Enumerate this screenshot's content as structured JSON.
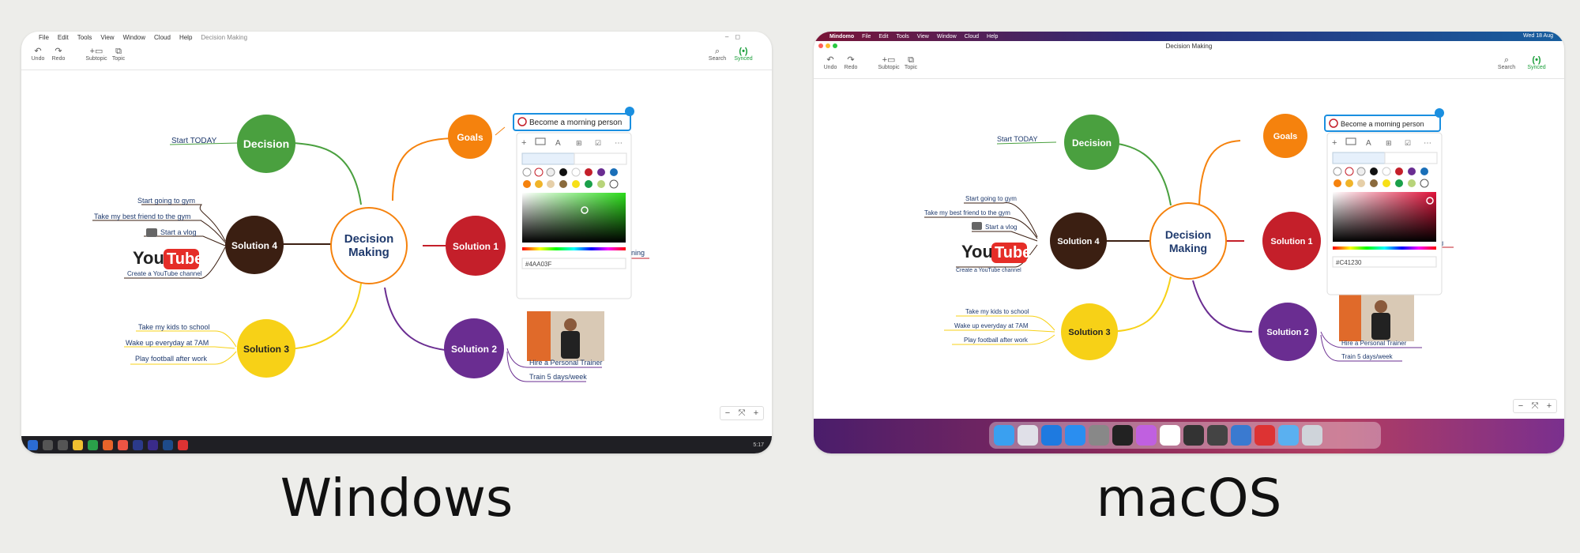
{
  "captions": {
    "windows": "Windows",
    "macos": "macOS"
  },
  "windows": {
    "menu": [
      "File",
      "Edit",
      "Tools",
      "View",
      "Window",
      "Cloud",
      "Help"
    ],
    "doc_title": "Decision Making",
    "toolbar": {
      "undo": "Undo",
      "redo": "Redo",
      "subtopic": "Subtopic",
      "topic": "Topic",
      "search": "Search",
      "synced": "Synced"
    },
    "color_hex": "#4AA03F",
    "taskbar_time": "5:17"
  },
  "macos": {
    "app_name": "Mindomo",
    "menu": [
      "File",
      "Edit",
      "Tools",
      "View",
      "Window",
      "Cloud",
      "Help"
    ],
    "status_time": "Wed 18 Aug",
    "doc_title": "Decision Making",
    "toolbar": {
      "undo": "Undo",
      "redo": "Redo",
      "subtopic": "Subtopic",
      "topic": "Topic",
      "search": "Search",
      "synced": "Synced"
    },
    "color_hex": "#C41230"
  },
  "mindmap": {
    "central": [
      "Decision",
      "Making"
    ],
    "nodes": {
      "decision": "Decision",
      "goals": "Goals",
      "solution1": "Solution 1",
      "solution2": "Solution 2",
      "solution3": "Solution 3",
      "solution4": "Solution 4"
    },
    "labels": {
      "start_today": "Start TODAY",
      "gym": "Start going to gym",
      "friend": "Take my best friend to the gym",
      "vlog": "Start a vlog",
      "youtube_channel": "Create a YouTube channel",
      "kids": "Take my kids to school",
      "wake": "Wake up everyday at 7AM",
      "football": "Play football after work",
      "trainer": "Hire a Personal Trainer",
      "train": "Train 5 days/week",
      "morning_person": "Become a morning person",
      "cut_text": "ning"
    },
    "youtube_logo": {
      "you": "You",
      "tube": "Tube"
    }
  },
  "colors": {
    "decision": "#4aa03f",
    "goals": "#f5820d",
    "solution1": "#c41f2a",
    "solution2": "#6a2d91",
    "solution3": "#f7d117",
    "solution4": "#3b1f12",
    "central_ring": "#f5820d",
    "central_text": "#1f3a6d",
    "selection": "#1a8fe0"
  },
  "icons": {
    "undo": "undo-icon",
    "redo": "redo-icon",
    "search": "search-icon",
    "sync": "sync-icon"
  }
}
